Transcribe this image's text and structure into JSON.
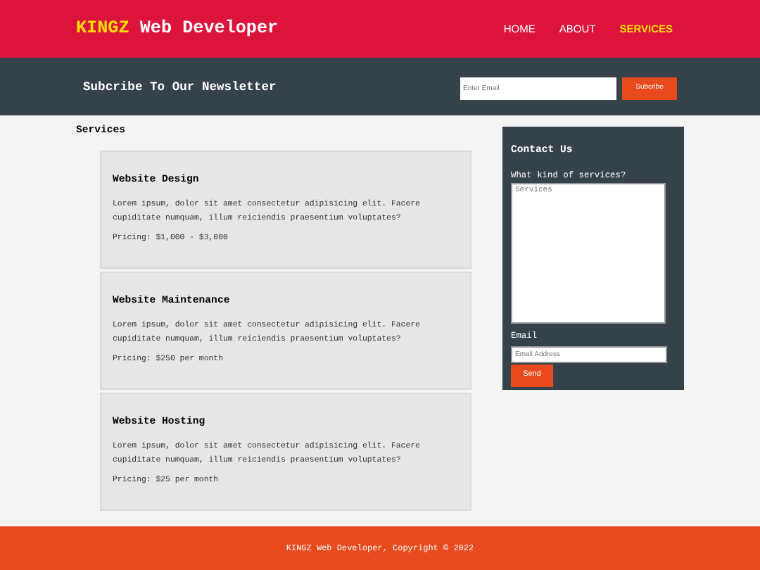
{
  "header": {
    "brand_highlight": "KINGZ",
    "brand_rest": "Web Developer",
    "nav": [
      {
        "label": "HOME",
        "selected": false
      },
      {
        "label": "ABOUT",
        "selected": false
      },
      {
        "label": "SERVICES",
        "selected": true
      }
    ]
  },
  "newsletter": {
    "title": "Subcribe To Our Newsletter",
    "email_placeholder": "Enter Email",
    "button": "Subcribe"
  },
  "services": {
    "heading": "Services",
    "cards": [
      {
        "title": "Website Design",
        "text": "Lorem ipsum, dolor sit amet consectetur adipisicing elit. Facere cupiditate numquam, illum reiciendis praesentium voluptates?",
        "pricing": "Pricing: $1,000 - $3,000"
      },
      {
        "title": "Website Maintenance",
        "text": "Lorem ipsum, dolor sit amet consectetur adipisicing elit. Facere cupiditate numquam, illum reiciendis praesentium voluptates?",
        "pricing": "Pricing: $250 per month"
      },
      {
        "title": "Website Hosting",
        "text": "Lorem ipsum, dolor sit amet consectetur adipisicing elit. Facere cupiditate numquam, illum reiciendis praesentium voluptates?",
        "pricing": "Pricing: $25 per month"
      }
    ]
  },
  "contact": {
    "title": "Contact Us",
    "services_label": "What kind of services?",
    "services_placeholder": "Services",
    "email_label": "Email",
    "email_placeholder": "Email Address",
    "button": "Send"
  },
  "footer": {
    "text": "KINGZ Web Developer, Copyright © 2022"
  }
}
